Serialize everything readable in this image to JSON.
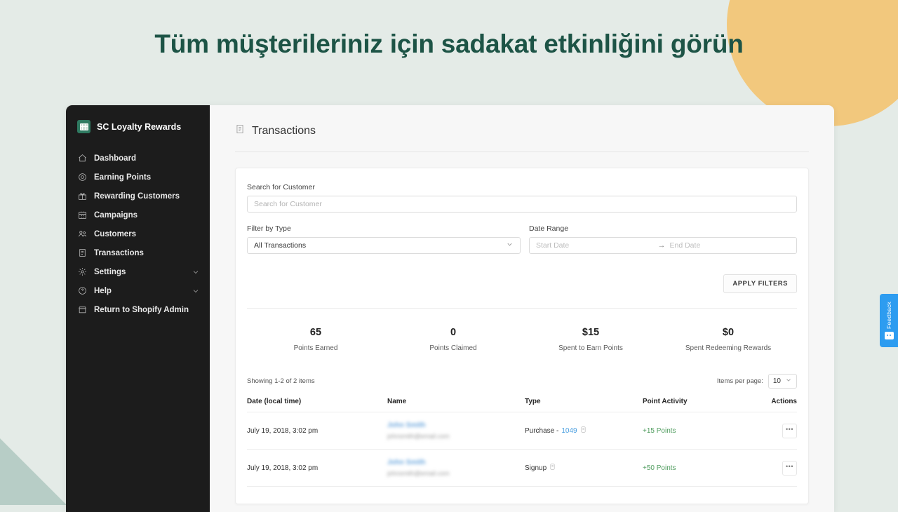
{
  "hero": {
    "heading": "Tüm müşterileriniz için sadakat etkinliğini görün"
  },
  "app": {
    "brand_name": "SC Loyalty Rewards",
    "sidebar": {
      "items": [
        {
          "label": "Dashboard",
          "icon": "home-icon",
          "chevron": false
        },
        {
          "label": "Earning Points",
          "icon": "target-icon",
          "chevron": false
        },
        {
          "label": "Rewarding Customers",
          "icon": "gift-icon",
          "chevron": false
        },
        {
          "label": "Campaigns",
          "icon": "calendar-icon",
          "chevron": false
        },
        {
          "label": "Customers",
          "icon": "people-icon",
          "chevron": false
        },
        {
          "label": "Transactions",
          "icon": "list-icon",
          "chevron": false
        },
        {
          "label": "Settings",
          "icon": "gear-icon",
          "chevron": true
        },
        {
          "label": "Help",
          "icon": "question-circle-icon",
          "chevron": true
        },
        {
          "label": "Return to Shopify Admin",
          "icon": "store-icon",
          "chevron": false
        }
      ]
    },
    "page": {
      "title": "Transactions",
      "title_icon": "document-list-icon"
    },
    "filters": {
      "search_label": "Search for Customer",
      "search_value": "",
      "search_placeholder": "Search for Customer",
      "type_label": "Filter by Type",
      "type_value": "All Transactions",
      "date_label": "Date Range",
      "start_value": "",
      "start_placeholder": "Start Date",
      "end_value": "",
      "end_placeholder": "End Date",
      "range_arrow": "→",
      "apply_label": "APPLY FILTERS"
    },
    "stats": [
      {
        "value": "65",
        "label": "Points Earned"
      },
      {
        "value": "0",
        "label": "Points Claimed"
      },
      {
        "value": "$15",
        "label": "Spent to Earn Points"
      },
      {
        "value": "$0",
        "label": "Spent Redeeming Rewards"
      }
    ],
    "pagination": {
      "showing": "Showing 1-2 of 2 items",
      "items_per_page_label": "Items per page:",
      "items_per_page_value": "10"
    },
    "table": {
      "columns": [
        "Date (local time)",
        "Name",
        "Type",
        "Point Activity",
        "Actions"
      ],
      "rows": [
        {
          "date": "July 19, 2018, 3:02 pm",
          "name": "John Smith",
          "email": "johnsmith@email.com",
          "type_text": "Purchase - ",
          "type_link": "1049",
          "points": "+15 Points",
          "action": "•••"
        },
        {
          "date": "July 19, 2018, 3:02 pm",
          "name": "John Smith",
          "email": "johnsmith@email.com",
          "type_text": "Signup",
          "type_link": "",
          "points": "+50 Points",
          "action": "•••"
        }
      ]
    }
  },
  "feedback": {
    "label": "Feedback",
    "icon": "chat-icon"
  },
  "colors": {
    "heading": "#1d5446",
    "background": "#e4ebe7",
    "circle": "#f2c87d",
    "triangle": "#b7cdc6",
    "sidebar": "#1c1c1c",
    "brand_green": "#2f7a61",
    "link_blue": "#4a9fe0",
    "points_green": "#4f9c5e",
    "feedback_blue": "#2d9cf0"
  }
}
